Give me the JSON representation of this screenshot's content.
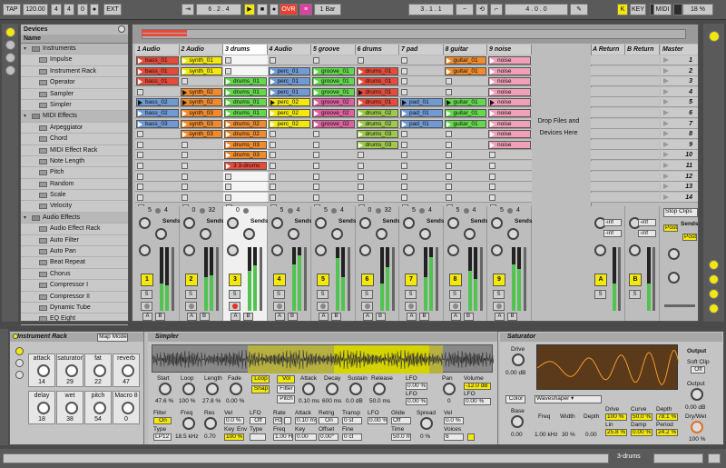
{
  "transport": {
    "tap": "TAP",
    "tempo": "120.00",
    "sig_num": "4",
    "sig_den": "4",
    "metro_count": "0",
    "ext": "EXT",
    "position": "6 . 2 . 4",
    "ovr": "OVR",
    "quantize": "1 Bar",
    "loop_start": "3 . 1 . 1",
    "loop_length": "4 . 0 . 0",
    "key": "KEY",
    "midi": "MIDI",
    "cpu": "18 %"
  },
  "browser": {
    "title": "Devices",
    "column": "Name",
    "items": [
      {
        "label": "Instruments",
        "type": "folder",
        "indent": 0
      },
      {
        "label": "Impulse",
        "type": "item",
        "indent": 1
      },
      {
        "label": "Instrument Rack",
        "type": "item",
        "indent": 1
      },
      {
        "label": "Operator",
        "type": "item",
        "indent": 1
      },
      {
        "label": "Sampler",
        "type": "item",
        "indent": 1
      },
      {
        "label": "Simpler",
        "type": "item",
        "indent": 1
      },
      {
        "label": "MIDI Effects",
        "type": "folder",
        "indent": 0
      },
      {
        "label": "Arpeggiator",
        "type": "item",
        "indent": 1
      },
      {
        "label": "Chord",
        "type": "item",
        "indent": 1
      },
      {
        "label": "MIDI Effect Rack",
        "type": "item",
        "indent": 1
      },
      {
        "label": "Note Length",
        "type": "item",
        "indent": 1
      },
      {
        "label": "Pitch",
        "type": "item",
        "indent": 1
      },
      {
        "label": "Random",
        "type": "item",
        "indent": 1
      },
      {
        "label": "Scale",
        "type": "item",
        "indent": 1
      },
      {
        "label": "Velocity",
        "type": "item",
        "indent": 1
      },
      {
        "label": "Audio Effects",
        "type": "folder",
        "indent": 0
      },
      {
        "label": "Audio Effect Rack",
        "type": "item",
        "indent": 1
      },
      {
        "label": "Auto Filter",
        "type": "item",
        "indent": 1
      },
      {
        "label": "Auto Pan",
        "type": "item",
        "indent": 1
      },
      {
        "label": "Beat Repeat",
        "type": "item",
        "indent": 1
      },
      {
        "label": "Chorus",
        "type": "item",
        "indent": 1
      },
      {
        "label": "Compressor I",
        "type": "item",
        "indent": 1
      },
      {
        "label": "Compressor II",
        "type": "item",
        "indent": 1
      },
      {
        "label": "Dynamic Tube",
        "type": "item",
        "indent": 1
      },
      {
        "label": "EQ Eight",
        "type": "item",
        "indent": 1
      }
    ]
  },
  "tracks": [
    {
      "name": "1 Audio",
      "num": "1",
      "in": "5",
      "out": "4",
      "clips": [
        {
          "name": "bass_01",
          "color": "#e84a3a"
        },
        {
          "name": "bass_01",
          "color": "#e84a3a"
        },
        {
          "name": "bass_01",
          "color": "#e84a3a"
        },
        null,
        {
          "name": "bass_02",
          "color": "#6f9ad6",
          "playing": true
        },
        {
          "name": "bass_02",
          "color": "#6f9ad6"
        },
        {
          "name": "bass_03",
          "color": "#6f9ad6"
        }
      ]
    },
    {
      "name": "2 Audio",
      "num": "2",
      "in": "0",
      "out": "32",
      "clips": [
        {
          "name": "synth_01",
          "color": "#f4e80a"
        },
        {
          "name": "synth_01",
          "color": "#f4e80a"
        },
        null,
        {
          "name": "synth_02",
          "color": "#f08a2a",
          "playing": true
        },
        {
          "name": "synth_02",
          "color": "#f08a2a",
          "playing": true
        },
        {
          "name": "synth_03",
          "color": "#f08a2a"
        },
        {
          "name": "synth_03",
          "color": "#f08a2a"
        },
        {
          "name": "synth_03",
          "color": "#f08a2a"
        }
      ]
    },
    {
      "name": "3 drums",
      "num": "3",
      "in": "0",
      "out": "",
      "selected": true,
      "clips": [
        null,
        null,
        {
          "name": "drums_01",
          "color": "#62d84a"
        },
        {
          "name": "drums_01",
          "color": "#62d84a"
        },
        {
          "name": "drums_01",
          "color": "#62d84a"
        },
        {
          "name": "drums_01",
          "color": "#62d84a"
        },
        {
          "name": "drums_02",
          "color": "#f08a2a"
        },
        {
          "name": "drums_02",
          "color": "#f08a2a"
        },
        {
          "name": "drums_03",
          "color": "#f08a2a"
        },
        {
          "name": "drums_03",
          "color": "#f08a2a"
        },
        {
          "name": "3 3-drums",
          "color": "#e84a3a"
        }
      ]
    },
    {
      "name": "4 Audio",
      "num": "4",
      "in": "5",
      "out": "4",
      "clips": [
        null,
        {
          "name": "perc_01",
          "color": "#6f9ad6"
        },
        {
          "name": "perc_01",
          "color": "#6f9ad6"
        },
        {
          "name": "perc_01",
          "color": "#6f9ad6"
        },
        {
          "name": "perc_02",
          "color": "#f4e80a",
          "playing": true
        },
        {
          "name": "perc_02",
          "color": "#f4e80a"
        },
        {
          "name": "perc_02",
          "color": "#f4e80a"
        }
      ]
    },
    {
      "name": "5 groove",
      "num": "5",
      "in": "5",
      "out": "4",
      "clips": [
        null,
        {
          "name": "groove_01",
          "color": "#62d84a"
        },
        {
          "name": "groove_01",
          "color": "#62d84a"
        },
        {
          "name": "groove_01",
          "color": "#62d84a"
        },
        {
          "name": "groove_02",
          "color": "#e060a0"
        },
        {
          "name": "groove_02",
          "color": "#e060a0"
        },
        {
          "name": "groove_02",
          "color": "#e060a0"
        }
      ]
    },
    {
      "name": "6 drums",
      "num": "6",
      "in": "0",
      "out": "32",
      "clips": [
        null,
        {
          "name": "drums_01",
          "color": "#e84a3a"
        },
        {
          "name": "drums_01",
          "color": "#e84a3a"
        },
        {
          "name": "drums_01",
          "color": "#e84a3a",
          "playing": true
        },
        {
          "name": "drums_01",
          "color": "#e84a3a"
        },
        {
          "name": "drums_02",
          "color": "#9ec94a"
        },
        {
          "name": "drums_02",
          "color": "#9ec94a"
        },
        {
          "name": "drums_03",
          "color": "#9ec94a"
        },
        {
          "name": "drums_03",
          "color": "#9ec94a"
        }
      ]
    },
    {
      "name": "7 pad",
      "num": "7",
      "in": "5",
      "out": "4",
      "clips": [
        null,
        null,
        null,
        null,
        {
          "name": "pad_01",
          "color": "#6f9ad6",
          "playing": true
        },
        {
          "name": "pad_01",
          "color": "#6f9ad6"
        },
        {
          "name": "pad_01",
          "color": "#6f9ad6"
        }
      ]
    },
    {
      "name": "8 guitar",
      "num": "8",
      "in": "5",
      "out": "4",
      "clips": [
        {
          "name": "guitar_01",
          "color": "#f08a2a"
        },
        {
          "name": "guitar_01",
          "color": "#f08a2a"
        },
        null,
        null,
        {
          "name": "guitar_01",
          "color": "#62d84a",
          "playing": true
        },
        {
          "name": "guitar_01",
          "color": "#62d84a"
        },
        {
          "name": "guitar_01",
          "color": "#62d84a"
        }
      ]
    },
    {
      "name": "9 noise",
      "num": "9",
      "in": "5",
      "out": "4",
      "clips": [
        {
          "name": "noise",
          "color": "#f0a0b8"
        },
        {
          "name": "noise",
          "color": "#f0a0b8"
        },
        {
          "name": "noise",
          "color": "#f0a0b8"
        },
        {
          "name": "noise",
          "color": "#f0a0b8"
        },
        {
          "name": "noise",
          "color": "#f0a0b8",
          "playing": true
        },
        {
          "name": "noise",
          "color": "#f0a0b8"
        },
        {
          "name": "noise",
          "color": "#f0a0b8"
        },
        {
          "name": "noise",
          "color": "#f0a0b8"
        },
        {
          "name": "noise",
          "color": "#f0a0b8"
        }
      ]
    }
  ],
  "drop_text": [
    "Drop Files and",
    "Devices Here"
  ],
  "returns": [
    {
      "name": "A Return",
      "label": "A",
      "val": "-inf"
    },
    {
      "name": "B Return",
      "label": "B",
      "val": "-inf"
    }
  ],
  "master": {
    "name": "Master",
    "scenes": [
      "1",
      "2",
      "3",
      "4",
      "5",
      "6",
      "7",
      "8",
      "9",
      "10",
      "11",
      "12",
      "13",
      "14"
    ],
    "stop_clips": "Stop Clips",
    "post": "Post"
  },
  "sends_label": "Sends",
  "instrument_rack": {
    "title": "Instrument Rack",
    "map_mode": "Map Mode",
    "macros": [
      {
        "name": "attack",
        "value": "14"
      },
      {
        "name": "saturator",
        "value": "29"
      },
      {
        "name": "fat",
        "value": "22"
      },
      {
        "name": "reverb",
        "value": "47"
      },
      {
        "name": "delay",
        "value": "18"
      },
      {
        "name": "wet",
        "value": "38"
      },
      {
        "name": "pitch",
        "value": "54"
      },
      {
        "name": "Macro 8",
        "value": "0"
      }
    ]
  },
  "simpler": {
    "title": "Simpler",
    "params": [
      {
        "label": "Start",
        "value": "47.6 %"
      },
      {
        "label": "Loop",
        "value": "100 %"
      },
      {
        "label": "Length",
        "value": "27.8 %"
      },
      {
        "label": "Fade",
        "value": "0.00 %"
      }
    ],
    "loop_btn": "Loop",
    "snap_btn": "Snap",
    "vol_btn": "Vol",
    "filter_btn": "Filter",
    "pitch_btn": "Pitch",
    "env": [
      {
        "label": "Attack",
        "value": "0.10 ms"
      },
      {
        "label": "Decay",
        "value": "600 ms"
      },
      {
        "label": "Sustain",
        "value": "0.0 dB"
      },
      {
        "label": "Release",
        "value": "50.0 ms"
      }
    ],
    "lfo_hz": "0.00 %",
    "rand": "0.00 %",
    "pan_label": "Pan",
    "pan_value": "0",
    "volume_label": "Volume",
    "volume_value": "-12.0 dB",
    "lfo_pct": "0.00 %",
    "filter_row": {
      "filter_label": "Filter",
      "filter_on": "On",
      "type_label": "Type",
      "type_val": "LP12",
      "freq_label": "Freq",
      "freq_val": "18.5 kHz",
      "res_label": "Res",
      "res_val": "0.70",
      "vel_label": "Vel",
      "vel_val": "0.0 %",
      "vel2": "100 %",
      "key_label": "Key",
      "key_val": "0.0 %",
      "env_label": "Env",
      "env_val": "0.0",
      "lfo_label": "LFO",
      "lfo_off": "Off",
      "lfo_type": "Type",
      "rate_label": "Rate",
      "rate_hz": "Hz",
      "rate_val": "1.00 Hz",
      "attack_label": "Attack",
      "attack_val": "0.10 ms",
      "key2_label": "Key",
      "key2_val": "0.00",
      "retrig_label": "Retrig",
      "retrig_val": "On",
      "offset_label": "Offset",
      "offset_val": "0.00°",
      "transp_label": "Transp",
      "transp_val": "0 st",
      "fine_label": "Fine",
      "fine_val": "0 ct",
      "lfo2_label": "LFO",
      "lfo2_val": "0.00 %",
      "glide_label": "Glide",
      "glide_val": "Off",
      "time_label": "Time",
      "time_val": "50.0 ms",
      "spread_label": "Spread",
      "spread_val": "0 %",
      "vel3_label": "Vel",
      "vel3_val": "0.0 %",
      "voices_label": "Voices",
      "voices_val": "6"
    }
  },
  "saturator": {
    "title": "Saturator",
    "drive_label": "Drive",
    "drive_val": "0.00 dB",
    "color_btn": "Color",
    "mode": "Waveshaper",
    "base_label": "Base",
    "base_val": "0.00",
    "freq_label": "Freq",
    "freq_val": "1.00 kHz",
    "width_label": "Width",
    "width_val": "30 %",
    "depth_label": "Depth",
    "depth_val": "0.00",
    "ws": [
      {
        "label": "Drive",
        "value": "100 %"
      },
      {
        "label": "Curve",
        "value": "50.0 %"
      },
      {
        "label": "Depth",
        "value": "78.1 %"
      },
      {
        "label": "Lin",
        "value": "25.8 %"
      },
      {
        "label": "Damp",
        "value": "0.00 %"
      },
      {
        "label": "Period",
        "value": "24.2 %"
      }
    ],
    "output_label": "Output",
    "soft_clip": "Soft Clip",
    "soft_clip_val": "Off",
    "out_label": "Output",
    "out_val": "0.00 dB",
    "drywet_label": "Dry/Wet",
    "drywet_val": "100 %"
  },
  "status": {
    "track": "3-drums"
  }
}
